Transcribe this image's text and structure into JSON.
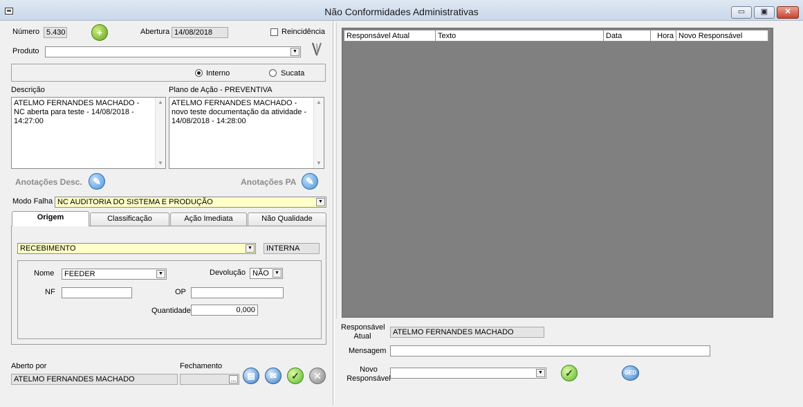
{
  "window": {
    "title": "Não Conformidades Administrativas",
    "minimize_glyph": "▭",
    "maximize_glyph": "▣",
    "close_glyph": "✕"
  },
  "header": {
    "numero_label": "Número",
    "numero_value": "5.430",
    "abertura_label": "Abertura",
    "abertura_value": "14/08/2018",
    "reincidencia_label": "Reincidência",
    "reincidencia_checked": false,
    "produto_label": "Produto",
    "produto_value": ""
  },
  "tipo": {
    "interno_label": "Interno",
    "sucata_label": "Sucata",
    "selected": "Interno"
  },
  "descricao": {
    "label": "Descrição",
    "text": "ATELMO FERNANDES MACHADO - NC aberta para teste - 14/08/2018 - 14:27:00"
  },
  "plano": {
    "label": "Plano de Ação - PREVENTIVA",
    "text": "ATELMO FERNANDES MACHADO - novo teste documentação da atividade - 14/08/2018 - 14:28:00"
  },
  "anotacoes": {
    "desc_label": "Anotações Desc.",
    "pa_label": "Anotações PA"
  },
  "modo_falha": {
    "label": "Modo Falha",
    "value": "NC AUDITORIA DO SISTEMA E PRODUÇÃO"
  },
  "tabs": [
    {
      "label": "Origem"
    },
    {
      "label": "Classificação"
    },
    {
      "label": "Ação Imediata"
    },
    {
      "label": "Não Qualidade"
    }
  ],
  "origem": {
    "tipo_value": "RECEBIMENTO",
    "classe_value": "INTERNA",
    "nome_label": "Nome",
    "nome_value": "FEEDER",
    "devolucao_label": "Devolução",
    "devolucao_value": "NÃO",
    "nf_label": "NF",
    "nf_value": "",
    "op_label": "OP",
    "op_value": "",
    "quantidade_label": "Quantidade",
    "quantidade_value": "0,000"
  },
  "footer": {
    "aberto_por_label": "Aberto por",
    "aberto_por_value": "ATELMO FERNANDES MACHADO",
    "fechamento_label": "Fechamento",
    "fechamento_value": ""
  },
  "grid": {
    "columns": [
      "Responsável Atual",
      "Texto",
      "Data",
      "Hora",
      "Novo Responsável"
    ],
    "rows": []
  },
  "right_form": {
    "responsavel_label": "Responsável Atual",
    "responsavel_value": "ATELMO FERNANDES MACHADO",
    "mensagem_label": "Mensagem",
    "mensagem_value": "",
    "novo_label": "Novo Responsável",
    "novo_value": "",
    "ged_label": "GED"
  },
  "icons": {
    "add": "plus-icon",
    "tools": "tools-icon",
    "anotacao": "note-icon",
    "confirm": "check-icon",
    "cancel": "cancel-icon",
    "print": "printer-icon",
    "email": "email-icon",
    "ellipsis": "..."
  },
  "colors": {
    "grid_background": "#808080",
    "highlight_field": "#ffffc8",
    "confirm_green": "#5cb82f",
    "note_blue": "#4f93d6"
  }
}
